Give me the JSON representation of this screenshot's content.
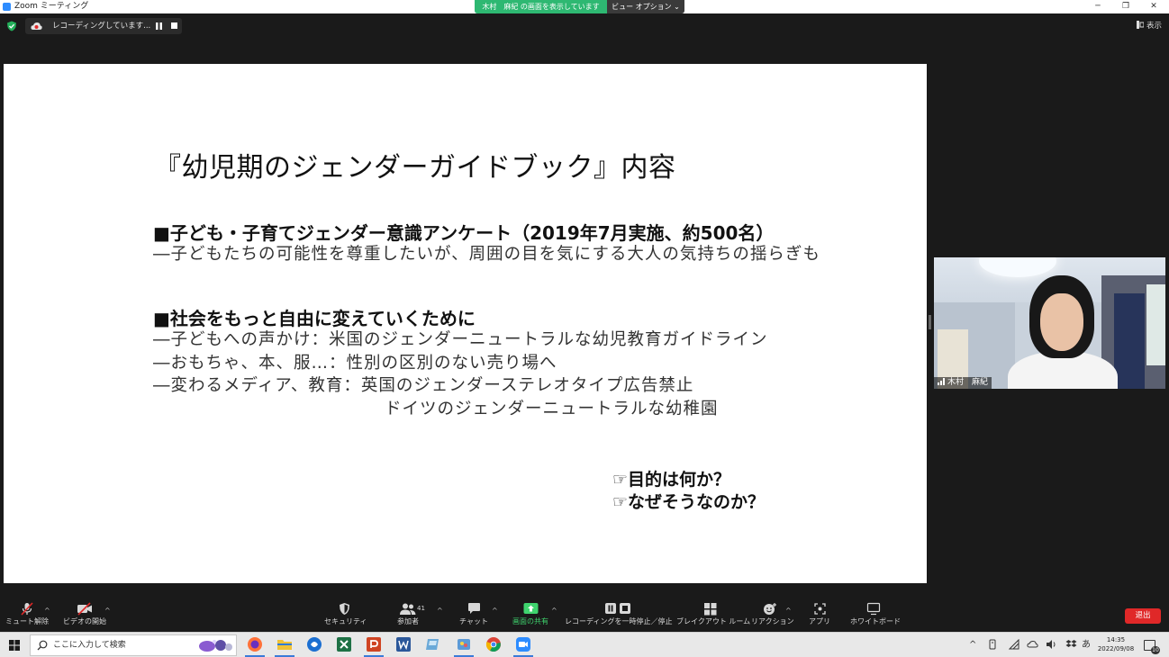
{
  "window": {
    "title": "Zoom ミーティング",
    "minimize": "─",
    "restore": "❐",
    "close": "✕"
  },
  "share_banner": "木村　麻紀 の画面を表示しています",
  "view_options": "ビュー オプション ⌄",
  "recording": {
    "status": "レコーディングしています...",
    "icon": "cloud-record-icon"
  },
  "display_button": "表示",
  "slide": {
    "title": "『幼児期のジェンダーガイドブック』内容",
    "section1_heading": "■子ども・子育てジェンダー意識アンケート（2019年7月実施、約500名）",
    "section1_sub": "―子どもたちの可能性を尊重したいが、周囲の目を気にする大人の気持ちの揺らぎも",
    "section2_heading": "■社会をもっと自由に変えていくために",
    "section2_items": [
      "―子どもへの声かけ：米国のジェンダーニュートラルな幼児教育ガイドライン",
      "―おもちゃ、本、服…：性別の区別のない売り場へ",
      "―変わるメディア、教育：英国のジェンダーステレオタイプ広告禁止",
      "ドイツのジェンダーニュートラルな幼稚園"
    ],
    "questions": [
      "☞目的は何か？",
      "☞なぜそうなのか？"
    ]
  },
  "participant": {
    "name": "木村　麻紀"
  },
  "toolbar": {
    "unmute": "ミュート解除",
    "start_video": "ビデオの開始",
    "security": "セキュリティ",
    "participants": "参加者",
    "participants_count": "41",
    "chat": "チャット",
    "share_screen": "画面の共有",
    "pause_stop_recording": "レコーディングを一時停止／停止",
    "breakout_rooms": "ブレイクアウト ルーム",
    "reactions": "リアクション",
    "apps": "アプリ",
    "whiteboard": "ホワイトボード",
    "leave": "退出",
    "accent_green": "#3fd46e",
    "leave_red": "#e02828"
  },
  "taskbar": {
    "search_placeholder": "ここに入力して検索",
    "ime": "あ",
    "time": "14:35",
    "date": "2022/09/08",
    "notifications": "10"
  }
}
